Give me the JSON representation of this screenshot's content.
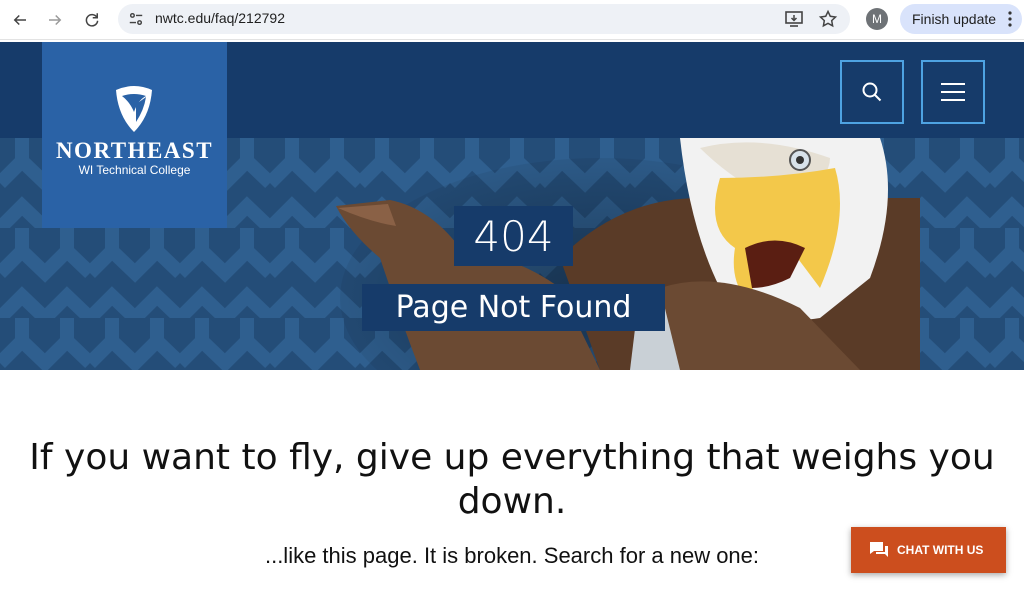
{
  "browser": {
    "url": "nwtc.edu/faq/212792",
    "profile_initial": "M",
    "finish_update_label": "Finish update"
  },
  "header": {
    "logo_name": "NORTHEAST",
    "logo_sub": "WI Technical College"
  },
  "hero": {
    "code": "404",
    "title": "Page Not Found"
  },
  "content": {
    "quote_line1": "If you want to fly, give up everything that weighs you",
    "quote_line2": "down.",
    "subtext": "...like this page. It is broken. Search for a new one:"
  },
  "chat": {
    "label": "CHAT WITH US"
  },
  "colors": {
    "header_navy": "#163b6a",
    "logo_blue": "#2a62a6",
    "button_border": "#4ea3e2",
    "chat_orange": "#cc4e1e"
  },
  "icons": [
    "back-icon",
    "forward-icon",
    "reload-icon",
    "site-info-icon",
    "install-icon",
    "star-icon",
    "more-icon",
    "shield-logo-icon",
    "search-icon",
    "hamburger-icon",
    "chat-icon"
  ]
}
